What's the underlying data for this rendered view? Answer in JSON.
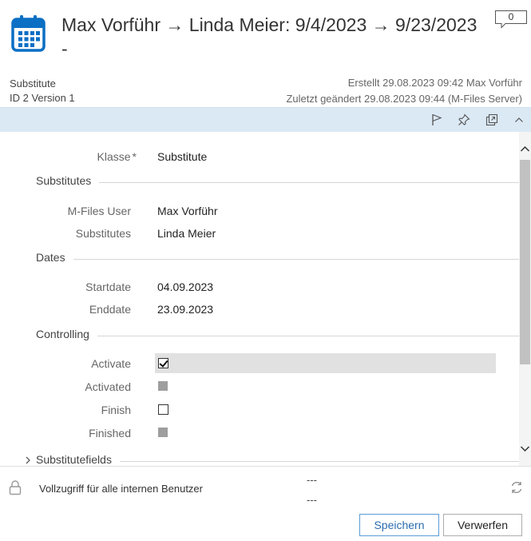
{
  "header": {
    "title": "Max Vorführ → Linda Meier: 9/4/2023 → 9/23/2023 -",
    "comment_count": "0",
    "object_class": "Substitute",
    "id_version": "ID 2  Version 1",
    "created": "Erstellt 29.08.2023 09:42 Max Vorführ",
    "modified": "Zuletzt geändert 29.08.2023 09:44 (M-Files Server)",
    "icon": "calendar-icon"
  },
  "toolbar": {
    "icons": [
      "flag-icon",
      "pin-icon",
      "pop-out-icon",
      "collapse-chevron-icon"
    ]
  },
  "properties": {
    "class": {
      "label": "Klasse",
      "required_mark": "*",
      "value": "Substitute"
    },
    "sections": {
      "substitutes": "Substitutes",
      "dates": "Dates",
      "controlling": "Controlling",
      "substitutefields": "Substitutefields"
    },
    "mfiles_user": {
      "label": "M-Files User",
      "value": "Max Vorführ"
    },
    "substitutes": {
      "label": "Substitutes",
      "value": "Linda Meier"
    },
    "startdate": {
      "label": "Startdate",
      "value": "04.09.2023"
    },
    "enddate": {
      "label": "Enddate",
      "value": "23.09.2023"
    },
    "activate": {
      "label": "Activate",
      "checked": true
    },
    "activated": {
      "label": "Activated",
      "readonly": true
    },
    "finish": {
      "label": "Finish",
      "checked": false
    },
    "finished": {
      "label": "Finished",
      "readonly": true
    }
  },
  "footer": {
    "permissions": "Vollzugriff für alle internen Benutzer",
    "dash_top": "---",
    "dash_bottom": "---",
    "save_label": "Speichern",
    "discard_label": "Verwerfen"
  },
  "colors": {
    "toolbar_bg": "#dbe9f5",
    "accent": "#0b6fc4",
    "save_border": "#5b9bd5"
  }
}
